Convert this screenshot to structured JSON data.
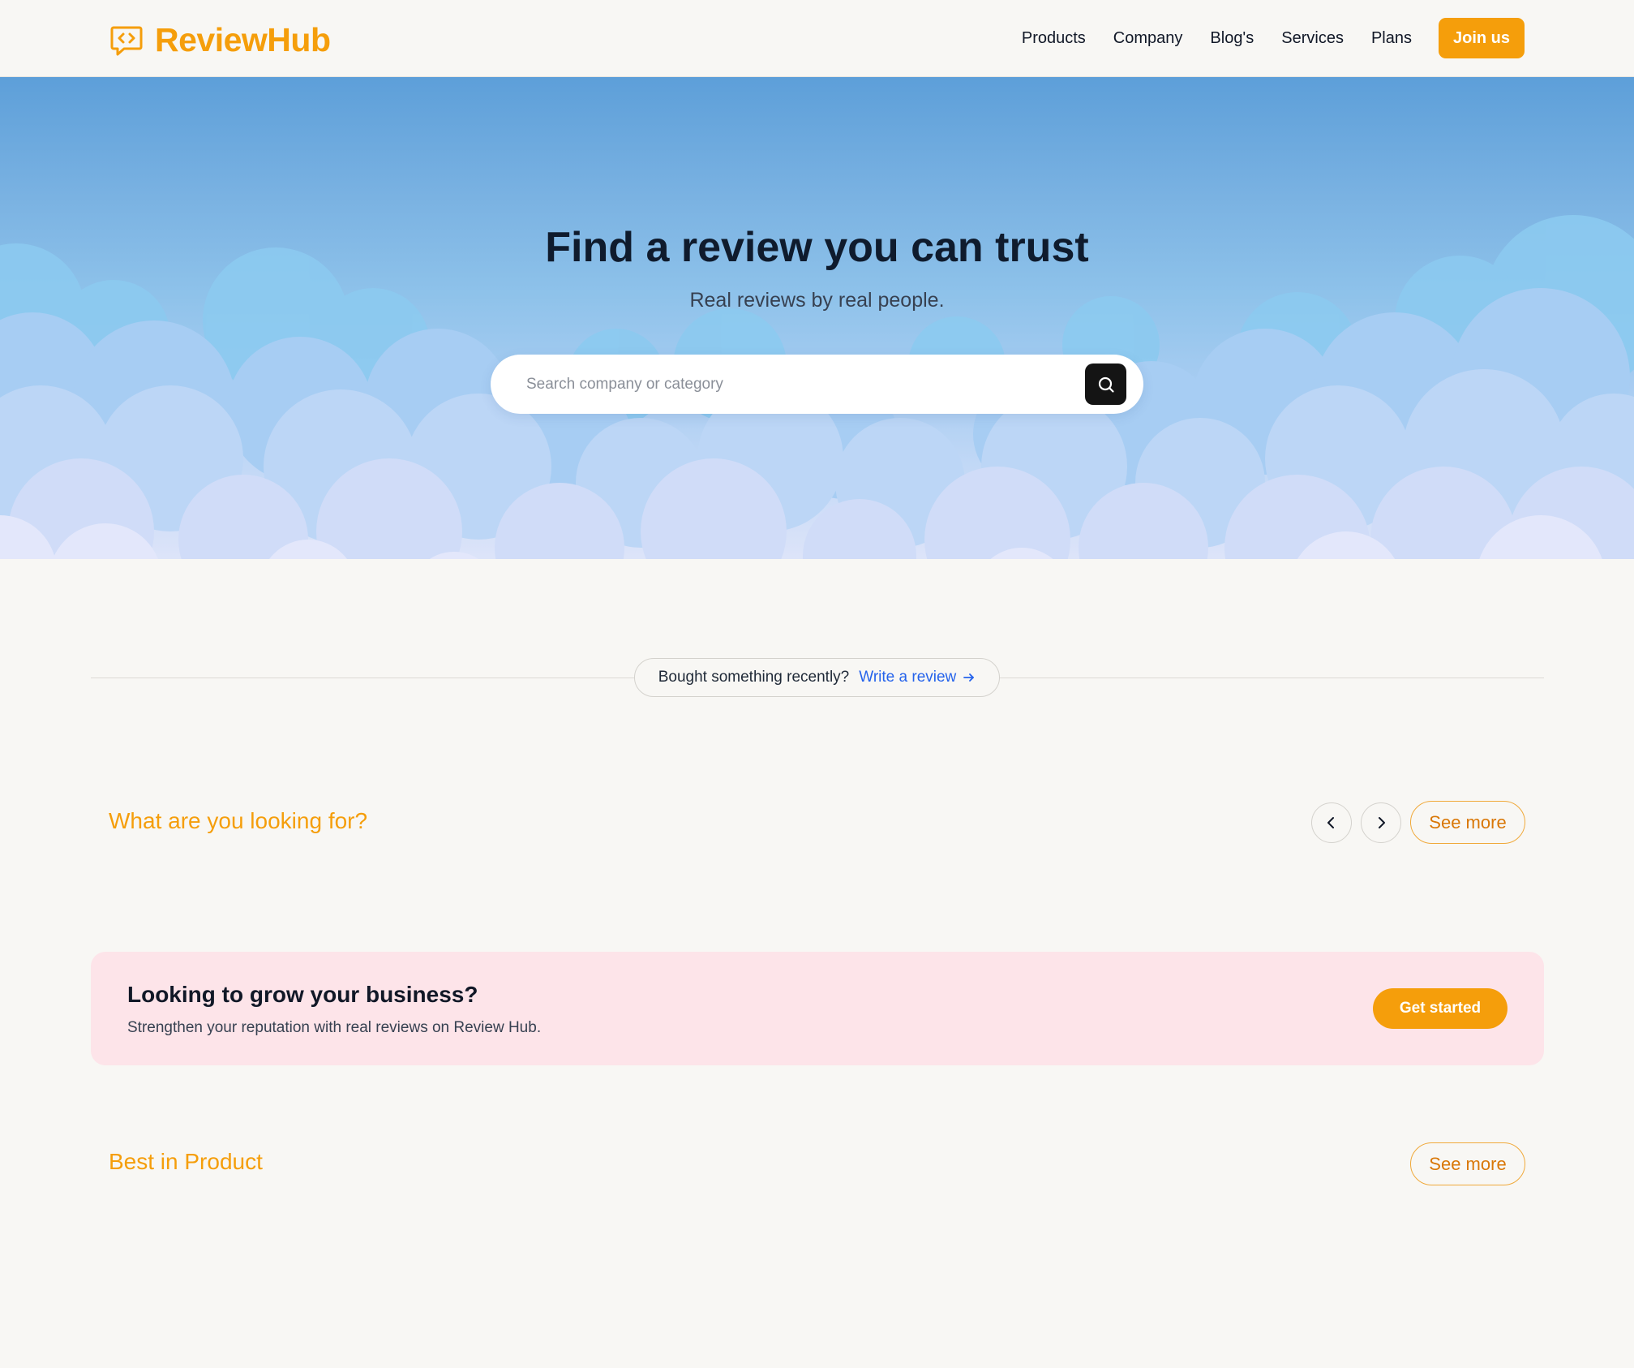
{
  "brand": {
    "name": "ReviewHub",
    "color": "#f59e0b"
  },
  "nav": {
    "items": [
      "Products",
      "Company",
      "Blog's",
      "Services",
      "Plans"
    ],
    "join_label": "Join us"
  },
  "hero": {
    "title": "Find a review you can trust",
    "subtitle": "Real reviews by real people.",
    "search_placeholder": "Search company or category",
    "search_value": ""
  },
  "review_prompt": {
    "text": "Bought something recently?",
    "link_label": "Write a review",
    "link_color": "#2563eb"
  },
  "looking_section": {
    "title": "What are you looking for?",
    "see_more_label": "See more"
  },
  "business_banner": {
    "title": "Looking to grow your business?",
    "subtitle": "Strengthen your reputation with real reviews on Review Hub.",
    "cta_label": "Get started",
    "background": "#fde4e9"
  },
  "product_section": {
    "title": "Best in Product",
    "see_more_label": "See more"
  }
}
